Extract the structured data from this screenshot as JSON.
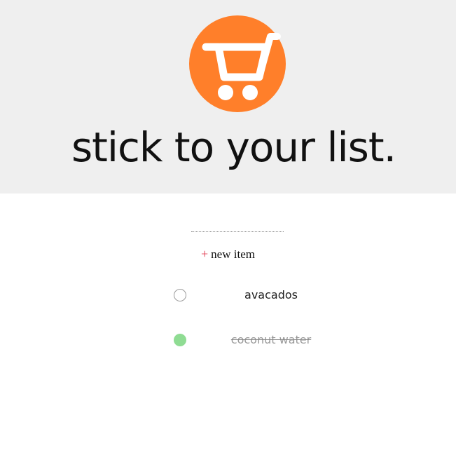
{
  "header": {
    "logo_icon": "shopping-cart-icon",
    "logo_color": "#ff7f2a",
    "title": "stick to your list."
  },
  "list": {
    "add_label": "new item",
    "add_icon": "+",
    "items": [
      {
        "label": "avacados",
        "done": false
      },
      {
        "label": "coconut water",
        "done": true
      }
    ]
  },
  "colors": {
    "header_bg": "#efefef",
    "accent_plus": "#e0354c",
    "done_check": "#8fdc93"
  }
}
